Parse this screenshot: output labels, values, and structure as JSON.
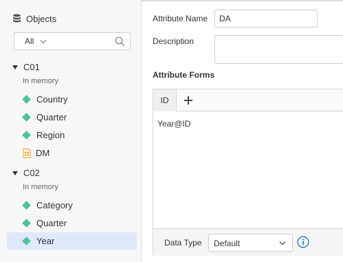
{
  "objects_panel": {
    "title": "Objects",
    "filter_value": "All",
    "groups": [
      {
        "name": "C01",
        "status": "In memory",
        "items": [
          {
            "label": "Country",
            "icon": "diamond-icon"
          },
          {
            "label": "Quarter",
            "icon": "diamond-icon"
          },
          {
            "label": "Region",
            "icon": "diamond-icon"
          },
          {
            "label": "DM",
            "icon": "document-icon"
          }
        ]
      },
      {
        "name": "C02",
        "status": "In memory",
        "items": [
          {
            "label": "Category",
            "icon": "diamond-icon"
          },
          {
            "label": "Quarter",
            "icon": "diamond-icon"
          },
          {
            "label": "Year",
            "icon": "diamond-icon",
            "selected": true
          }
        ]
      }
    ]
  },
  "attribute": {
    "name_label": "Attribute Name",
    "name_value": "DA",
    "description_label": "Description",
    "description_value": "",
    "forms_title": "Attribute Forms",
    "tab_label": "ID",
    "expression": "Year@ID",
    "data_type_label": "Data Type",
    "data_type_value": "Default"
  },
  "colors": {
    "accent": "#1f7ad6",
    "attribute_icon": "#4fc39a",
    "document_icon": "#f0a030",
    "selection": "#dfe9fa"
  }
}
